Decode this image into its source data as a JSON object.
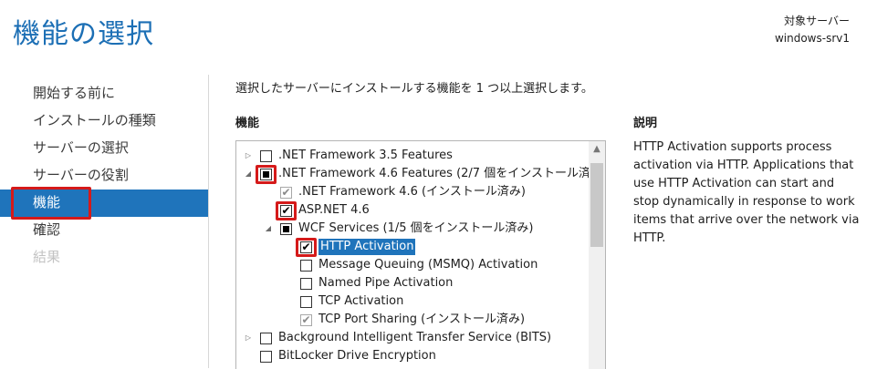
{
  "window": {
    "title": "機能の選択",
    "target_label": "対象サーバー",
    "target_server": "windows-srv1"
  },
  "nav": {
    "items": [
      {
        "label": "開始する前に",
        "state": "normal"
      },
      {
        "label": "インストールの種類",
        "state": "normal"
      },
      {
        "label": "サーバーの選択",
        "state": "normal"
      },
      {
        "label": "サーバーの役割",
        "state": "normal"
      },
      {
        "label": "機能",
        "state": "active"
      },
      {
        "label": "確認",
        "state": "normal"
      },
      {
        "label": "結果",
        "state": "disabled"
      }
    ]
  },
  "main": {
    "instruction": "選択したサーバーにインストールする機能を 1 つ以上選択します。",
    "features_header": "機能",
    "description_header": "説明",
    "description_text": "HTTP Activation supports process activation via HTTP. Applications that use HTTP Activation can start and stop dynamically in response to work items that arrive over the network via HTTP."
  },
  "features": [
    {
      "label": ".NET Framework 3.5 Features",
      "level": 0,
      "expander": "collapsed",
      "check": "unchecked"
    },
    {
      "label": ".NET Framework 4.6 Features (2/7 個をインストール済",
      "level": 0,
      "expander": "expanded",
      "check": "partial"
    },
    {
      "label": ".NET Framework 4.6 (インストール済み)",
      "level": 1,
      "expander": "none",
      "check": "checked-gray"
    },
    {
      "label": "ASP.NET 4.6",
      "level": 1,
      "expander": "none",
      "check": "checked"
    },
    {
      "label": "WCF Services (1/5 個をインストール済み)",
      "level": 1,
      "expander": "expanded",
      "check": "partial"
    },
    {
      "label": "HTTP Activation",
      "level": 2,
      "expander": "none",
      "check": "checked",
      "selected": true
    },
    {
      "label": "Message Queuing (MSMQ) Activation",
      "level": 2,
      "expander": "none",
      "check": "unchecked"
    },
    {
      "label": "Named Pipe Activation",
      "level": 2,
      "expander": "none",
      "check": "unchecked"
    },
    {
      "label": "TCP Activation",
      "level": 2,
      "expander": "none",
      "check": "unchecked"
    },
    {
      "label": "TCP Port Sharing (インストール済み)",
      "level": 2,
      "expander": "none",
      "check": "checked-gray"
    },
    {
      "label": "Background Intelligent Transfer Service (BITS)",
      "level": 0,
      "expander": "collapsed",
      "check": "unchecked"
    },
    {
      "label": "BitLocker Drive Encryption",
      "level": 0,
      "expander": "none",
      "check": "unchecked"
    }
  ],
  "colors": {
    "accent": "#1f74bb",
    "title": "#1c6fb5",
    "highlight": "#d51a1a"
  }
}
